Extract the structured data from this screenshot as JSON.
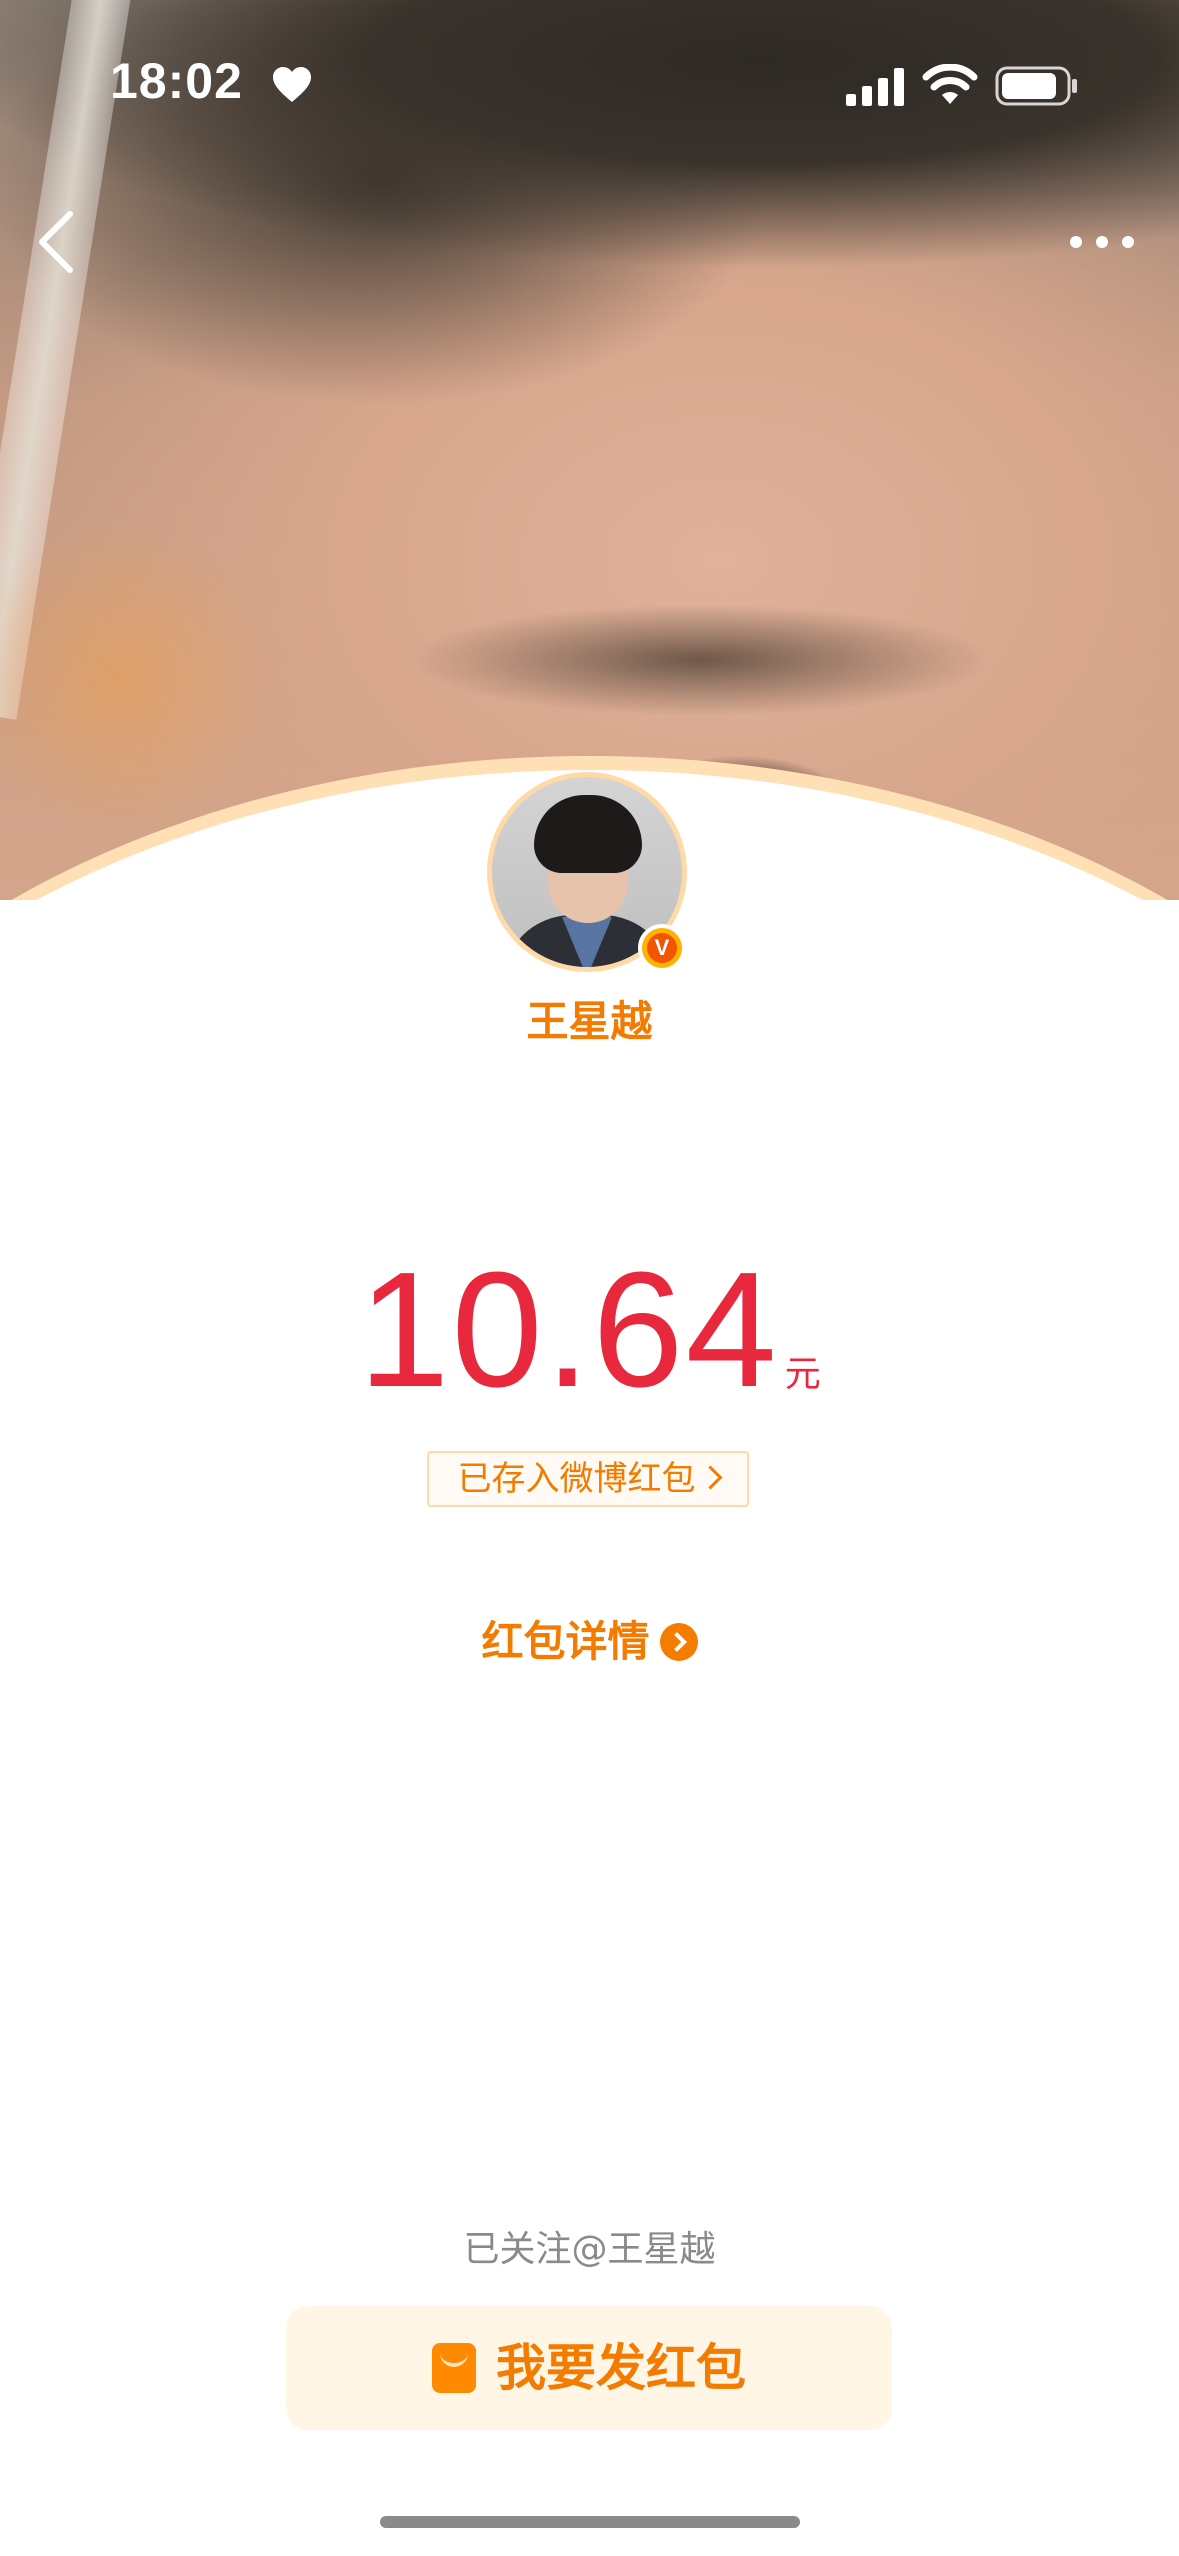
{
  "status_bar": {
    "time": "18:02",
    "icons": [
      "heart-icon",
      "signal-icon",
      "wifi-icon",
      "battery-icon"
    ]
  },
  "nav": {
    "back_icon": "chevron-left-icon",
    "more_icon": "more-dots-icon"
  },
  "sender": {
    "name": "王星越",
    "verified_badge": "V"
  },
  "amount": {
    "value": "10.64",
    "unit": "元"
  },
  "saved_tag": {
    "label": "已存入微博红包"
  },
  "details_link": {
    "label": "红包详情"
  },
  "footer": {
    "followed_text": "已关注@王星越",
    "send_button_label": "我要发红包"
  },
  "colors": {
    "accent_orange": "#f27b00",
    "amount_red": "#e8283c",
    "button_bg": "#fff6e6",
    "curve_outline": "#ffe0b5"
  }
}
